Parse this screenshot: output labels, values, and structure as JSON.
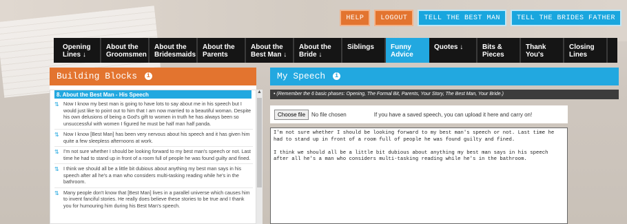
{
  "top_buttons": [
    {
      "label": "HELP",
      "color": "#e3742f"
    },
    {
      "label": "LOGOUT",
      "color": "#e3742f"
    },
    {
      "label": "TELL THE BEST MAN",
      "color": "#19a6de"
    },
    {
      "label": "TELL THE BRIDES FATHER",
      "color": "#19a6de"
    }
  ],
  "nav": [
    {
      "label": "Opening Lines ↓"
    },
    {
      "label": "About the Groomsmen"
    },
    {
      "label": "About the Bridesmaids"
    },
    {
      "label": "About the Parents"
    },
    {
      "label": "About the Best Man ↓"
    },
    {
      "label": "About the Bride ↓"
    },
    {
      "label": "Siblings"
    },
    {
      "label": "Funny Advice",
      "active": true
    },
    {
      "label": "Quotes ↓"
    },
    {
      "label": "Bits & Pieces"
    },
    {
      "label": "Thank You's"
    },
    {
      "label": "Closing Lines"
    }
  ],
  "left_panel": {
    "title": "Building Blocks",
    "section_title": "8. About the Best Man - His Speech",
    "items": [
      "Now I know my best man is going to have lots to say about me in his speech but I would just like to point out to him that I am now married to a beautiful woman. Despite his own delusions of being a God's gift to women in truth he has always been so unsuccessful with women I figured he must be half man half panda.",
      "Now I know [Best Man] has been very nervous about his speech and it has given him quite a few sleepless afternoons at work.",
      "I'm not sure whether I should be looking forward to my best man's speech or not. Last time he had to stand up in front of a room full of people he was found guilty and fined.",
      "I think we should all be a little bit dubious about anything my best man says in his speech after all he's a man who considers multi-tasking reading while he's in the bathroom.",
      "Many people don't know that [Best Man] lives in a parallel universe which causes him to invent fanciful stories. He really does believe these stories to be true and I thank you for humouring him during his Best Man's speech."
    ]
  },
  "right_panel": {
    "title": "My Speech",
    "tip": "• (Remember the 6 basic phases: Opening, The Formal Bit, Parents, Your Story, The Best Man, Your Bride.)",
    "choose_file_label": "Choose file",
    "no_file_text": "No file chosen",
    "upload_hint": "If you have a saved speech, you can upload it here and carry on!",
    "speech_text": "I'm not sure whether I should be looking forward to my best man's speech or not. Last time he had to stand up in front of a room full of people he was found guilty and fined.\n\nI think we should all be a little bit dubious about anything my best man says in his speech after all he's a man who considers multi-tasking reading while he's in the bathroom."
  },
  "colors": {
    "orange": "#e3742f",
    "blue": "#22a8e0",
    "nav_bg": "#151515"
  }
}
